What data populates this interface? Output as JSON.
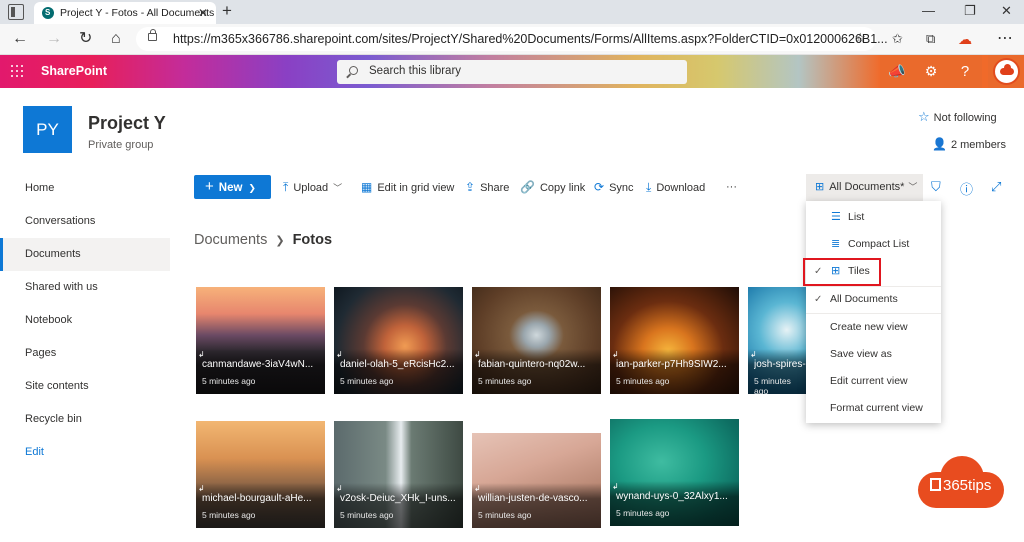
{
  "browser": {
    "tab_title": "Project Y - Fotos - All Documents",
    "url": "https://m365x366786.sharepoint.com/sites/ProjectY/Shared%20Documents/Forms/AllItems.aspx?FolderCTID=0x012000626B1..."
  },
  "suite": {
    "brand": "SharePoint",
    "search_placeholder": "Search this library"
  },
  "site": {
    "logo_initials": "PY",
    "title": "Project Y",
    "subtitle": "Private group",
    "follow_label": "Not following",
    "members_label": "2 members"
  },
  "nav": {
    "items": [
      {
        "label": "Home"
      },
      {
        "label": "Conversations"
      },
      {
        "label": "Documents",
        "active": true
      },
      {
        "label": "Shared with us"
      },
      {
        "label": "Notebook"
      },
      {
        "label": "Pages"
      },
      {
        "label": "Site contents"
      },
      {
        "label": "Recycle bin"
      }
    ],
    "edit_label": "Edit"
  },
  "commands": {
    "new": "New",
    "upload": "Upload",
    "edit_grid": "Edit in grid view",
    "share": "Share",
    "copy_link": "Copy link",
    "sync": "Sync",
    "download": "Download",
    "more": "···",
    "view_selector": "All Documents*"
  },
  "breadcrumb": {
    "root": "Documents",
    "current": "Fotos"
  },
  "tiles": [
    {
      "name": "canmandawe-3iaV4wN...",
      "meta": "5 minutes ago"
    },
    {
      "name": "daniel-olah-5_eRcisHc2...",
      "meta": "5 minutes ago"
    },
    {
      "name": "fabian-quintero-nq02w...",
      "meta": "5 minutes ago"
    },
    {
      "name": "ian-parker-p7Hh9SIW2...",
      "meta": "5 minutes ago"
    },
    {
      "name": "josh-spires-...",
      "meta": "5 minutes ago"
    },
    {
      "name": "michael-bourgault-aHe...",
      "meta": "5 minutes ago"
    },
    {
      "name": "v2osk-Deiuc_XHk_I-uns...",
      "meta": "5 minutes ago"
    },
    {
      "name": "willian-justen-de-vasco...",
      "meta": "5 minutes ago"
    },
    {
      "name": "wynand-uys-0_32Alxy1...",
      "meta": "5 minutes ago"
    }
  ],
  "view_menu": {
    "list": "List",
    "compact_list": "Compact List",
    "tiles": "Tiles",
    "all_documents": "All Documents",
    "create_new_view": "Create new view",
    "save_view_as": "Save view as",
    "edit_current_view": "Edit current view",
    "format_current_view": "Format current view"
  },
  "badge": {
    "text": "365tips"
  },
  "colors": {
    "accent": "#0e78d5",
    "highlight_border": "#e0161f",
    "badge": "#e84c1f"
  }
}
